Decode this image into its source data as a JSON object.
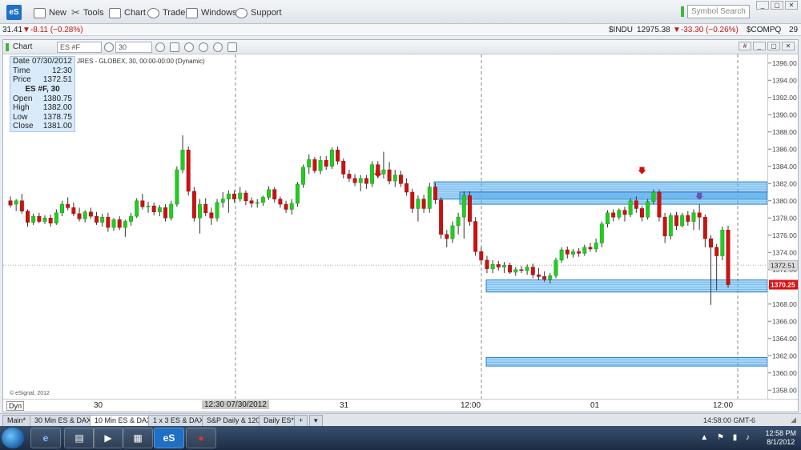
{
  "menubar": {
    "app_logo": "eS",
    "items": [
      "New",
      "Tools",
      "Chart",
      "Trade",
      "Windows",
      "Support"
    ],
    "symbol_search_placeholder": "Symbol Search"
  },
  "ticker": {
    "left_price": "31.41",
    "left_change": "▼-8.11 (−0.28%)",
    "indu_symbol": "$INDU",
    "indu_price": "12975.38",
    "indu_change": "▼-33.30 (−0.26%)",
    "compq_symbol": "$COMPQ",
    "compq_price": "29"
  },
  "chart_window": {
    "title": "Chart",
    "symbol": "ES #F",
    "interval": "30",
    "description": "JRES - GLOBEX, 30, 00:00-00:00 (Dynamic)",
    "copyright": "© eSignal, 2012",
    "dyn_label": "Dyn",
    "current_price_label": "1370.25",
    "crosshair_price_label": "1372.51",
    "crosshair_time_label": "12:30 07/30/2012"
  },
  "info_panel": {
    "rows": [
      {
        "label": "Date",
        "value": "07/30/2012"
      },
      {
        "label": "Time",
        "value": "12:30"
      },
      {
        "label": "Price",
        "value": "1372.51"
      }
    ],
    "header": "ES #F, 30",
    "ohlc": [
      {
        "label": "Open",
        "value": "1380.75"
      },
      {
        "label": "High",
        "value": "1382.00"
      },
      {
        "label": "Low",
        "value": "1378.75"
      },
      {
        "label": "Close",
        "value": "1381.00"
      }
    ]
  },
  "tabs": [
    {
      "label": "Main*",
      "active": false
    },
    {
      "label": "30 Min ES & DAX*",
      "active": false
    },
    {
      "label": "10 Min ES & DAX*",
      "active": true
    },
    {
      "label": "1 x 3 ES & DAX*",
      "active": false
    },
    {
      "label": "S&P Daily & 120*",
      "active": false
    },
    {
      "label": "Daily ES*",
      "active": false
    }
  ],
  "status_clock": "14:58:00 GMT-6",
  "taskbar": {
    "time": "12:58 PM",
    "date": "8/1/2012"
  },
  "colors": {
    "up_candle": "#22cc22",
    "down_candle": "#cc1111",
    "zone_fill": "#5fb4f0",
    "zone_stroke": "#1f7fd0",
    "price_flag": "#dd1111"
  },
  "chart_data": {
    "type": "candlestick",
    "ylim": [
      1357,
      1397
    ],
    "yticks": [
      1358,
      1360,
      1362,
      1364,
      1366,
      1368,
      1370,
      1372,
      1374,
      1376,
      1378,
      1380,
      1382,
      1384,
      1386,
      1388,
      1390,
      1392,
      1394,
      1396
    ],
    "xtick_labels": [
      "30",
      "31",
      "12:00",
      "01",
      "12:00"
    ],
    "zones": [
      {
        "from": 1380.2,
        "to": 1382.2
      },
      {
        "from": 1379.6,
        "to": 1381.0
      },
      {
        "from": 1369.4,
        "to": 1370.8
      },
      {
        "from": 1360.8,
        "to": 1361.8
      }
    ],
    "arrows": [
      {
        "price": 1382.6,
        "color": "#cc1111"
      },
      {
        "price": 1383.0,
        "color": "#cc1111"
      },
      {
        "price": 1380.0,
        "color": "#6a55b5"
      }
    ],
    "candles": [
      {
        "o": 1380.0,
        "h": 1380.5,
        "l": 1379.2,
        "c": 1379.5
      },
      {
        "o": 1379.6,
        "h": 1380.2,
        "l": 1378.8,
        "c": 1380.0
      },
      {
        "o": 1380.0,
        "h": 1380.8,
        "l": 1378.5,
        "c": 1378.8
      },
      {
        "o": 1378.8,
        "h": 1379.0,
        "l": 1377.0,
        "c": 1377.5
      },
      {
        "o": 1377.5,
        "h": 1378.5,
        "l": 1377.2,
        "c": 1378.2
      },
      {
        "o": 1378.2,
        "h": 1378.6,
        "l": 1377.4,
        "c": 1377.6
      },
      {
        "o": 1377.6,
        "h": 1378.3,
        "l": 1377.3,
        "c": 1378.0
      },
      {
        "o": 1378.0,
        "h": 1378.4,
        "l": 1377.0,
        "c": 1377.4
      },
      {
        "o": 1377.4,
        "h": 1379.0,
        "l": 1377.2,
        "c": 1378.6
      },
      {
        "o": 1378.6,
        "h": 1380.0,
        "l": 1378.2,
        "c": 1379.6
      },
      {
        "o": 1379.6,
        "h": 1380.4,
        "l": 1378.9,
        "c": 1379.2
      },
      {
        "o": 1379.2,
        "h": 1379.8,
        "l": 1378.2,
        "c": 1378.5
      },
      {
        "o": 1378.5,
        "h": 1379.2,
        "l": 1377.6,
        "c": 1377.9
      },
      {
        "o": 1377.9,
        "h": 1378.9,
        "l": 1377.5,
        "c": 1378.7
      },
      {
        "o": 1378.7,
        "h": 1379.2,
        "l": 1377.9,
        "c": 1378.2
      },
      {
        "o": 1378.2,
        "h": 1378.7,
        "l": 1377.2,
        "c": 1377.5
      },
      {
        "o": 1377.5,
        "h": 1378.5,
        "l": 1377.0,
        "c": 1378.1
      },
      {
        "o": 1378.1,
        "h": 1378.6,
        "l": 1376.4,
        "c": 1376.9
      },
      {
        "o": 1376.9,
        "h": 1378.0,
        "l": 1376.5,
        "c": 1377.8
      },
      {
        "o": 1377.8,
        "h": 1378.2,
        "l": 1376.6,
        "c": 1376.9
      },
      {
        "o": 1376.9,
        "h": 1377.8,
        "l": 1375.8,
        "c": 1377.6
      },
      {
        "o": 1377.6,
        "h": 1378.6,
        "l": 1377.1,
        "c": 1378.2
      },
      {
        "o": 1378.2,
        "h": 1380.3,
        "l": 1378.0,
        "c": 1380.0
      },
      {
        "o": 1380.0,
        "h": 1380.8,
        "l": 1379.0,
        "c": 1379.3
      },
      {
        "o": 1379.3,
        "h": 1379.9,
        "l": 1378.6,
        "c": 1379.4
      },
      {
        "o": 1379.4,
        "h": 1379.8,
        "l": 1378.3,
        "c": 1378.7
      },
      {
        "o": 1378.7,
        "h": 1379.5,
        "l": 1378.2,
        "c": 1379.2
      },
      {
        "o": 1379.2,
        "h": 1379.6,
        "l": 1377.6,
        "c": 1378.0
      },
      {
        "o": 1378.0,
        "h": 1380.0,
        "l": 1377.7,
        "c": 1379.6
      },
      {
        "o": 1379.6,
        "h": 1384.0,
        "l": 1379.3,
        "c": 1383.6
      },
      {
        "o": 1383.6,
        "h": 1387.6,
        "l": 1383.2,
        "c": 1385.9
      },
      {
        "o": 1385.9,
        "h": 1386.3,
        "l": 1380.6,
        "c": 1381.1
      },
      {
        "o": 1381.1,
        "h": 1381.6,
        "l": 1377.6,
        "c": 1378.0
      },
      {
        "o": 1378.0,
        "h": 1380.2,
        "l": 1376.2,
        "c": 1379.6
      },
      {
        "o": 1379.6,
        "h": 1380.3,
        "l": 1378.2,
        "c": 1378.6
      },
      {
        "o": 1378.6,
        "h": 1379.2,
        "l": 1377.2,
        "c": 1378.0
      },
      {
        "o": 1378.0,
        "h": 1380.2,
        "l": 1377.6,
        "c": 1379.8
      },
      {
        "o": 1379.8,
        "h": 1381.0,
        "l": 1379.2,
        "c": 1380.2
      },
      {
        "o": 1380.2,
        "h": 1381.2,
        "l": 1378.6,
        "c": 1380.8
      },
      {
        "o": 1380.8,
        "h": 1381.2,
        "l": 1379.8,
        "c": 1380.2
      },
      {
        "o": 1380.2,
        "h": 1381.6,
        "l": 1379.9,
        "c": 1380.9
      },
      {
        "o": 1380.9,
        "h": 1381.2,
        "l": 1379.5,
        "c": 1380.0
      },
      {
        "o": 1380.0,
        "h": 1380.4,
        "l": 1379.2,
        "c": 1379.7
      },
      {
        "o": 1379.7,
        "h": 1380.2,
        "l": 1379.2,
        "c": 1379.8
      },
      {
        "o": 1379.8,
        "h": 1380.6,
        "l": 1379.4,
        "c": 1380.4
      },
      {
        "o": 1380.4,
        "h": 1381.7,
        "l": 1380.1,
        "c": 1381.3
      },
      {
        "o": 1381.3,
        "h": 1381.6,
        "l": 1379.8,
        "c": 1380.2
      },
      {
        "o": 1380.2,
        "h": 1380.5,
        "l": 1379.2,
        "c": 1379.6
      },
      {
        "o": 1379.6,
        "h": 1380.0,
        "l": 1378.6,
        "c": 1379.0
      },
      {
        "o": 1379.0,
        "h": 1380.2,
        "l": 1378.4,
        "c": 1379.7
      },
      {
        "o": 1379.7,
        "h": 1382.2,
        "l": 1379.3,
        "c": 1381.9
      },
      {
        "o": 1381.9,
        "h": 1384.2,
        "l": 1381.5,
        "c": 1383.9
      },
      {
        "o": 1383.9,
        "h": 1385.4,
        "l": 1383.1,
        "c": 1384.8
      },
      {
        "o": 1384.8,
        "h": 1385.1,
        "l": 1383.2,
        "c": 1383.5
      },
      {
        "o": 1383.5,
        "h": 1385.2,
        "l": 1383.1,
        "c": 1384.7
      },
      {
        "o": 1384.7,
        "h": 1385.2,
        "l": 1383.6,
        "c": 1384.0
      },
      {
        "o": 1384.0,
        "h": 1386.2,
        "l": 1383.7,
        "c": 1385.9
      },
      {
        "o": 1385.9,
        "h": 1386.3,
        "l": 1384.2,
        "c": 1384.6
      },
      {
        "o": 1384.6,
        "h": 1384.9,
        "l": 1382.6,
        "c": 1383.1
      },
      {
        "o": 1383.1,
        "h": 1383.6,
        "l": 1382.2,
        "c": 1382.6
      },
      {
        "o": 1382.6,
        "h": 1383.1,
        "l": 1381.7,
        "c": 1382.1
      },
      {
        "o": 1382.1,
        "h": 1383.0,
        "l": 1381.1,
        "c": 1382.6
      },
      {
        "o": 1382.6,
        "h": 1383.0,
        "l": 1381.4,
        "c": 1382.0
      },
      {
        "o": 1382.0,
        "h": 1384.6,
        "l": 1381.6,
        "c": 1384.2
      },
      {
        "o": 1384.2,
        "h": 1384.6,
        "l": 1382.6,
        "c": 1383.1
      },
      {
        "o": 1383.1,
        "h": 1385.7,
        "l": 1382.6,
        "c": 1383.6
      },
      {
        "o": 1383.6,
        "h": 1384.5,
        "l": 1381.9,
        "c": 1382.3
      },
      {
        "o": 1382.3,
        "h": 1383.6,
        "l": 1381.6,
        "c": 1383.0
      },
      {
        "o": 1383.0,
        "h": 1383.5,
        "l": 1381.6,
        "c": 1382.0
      },
      {
        "o": 1382.0,
        "h": 1382.6,
        "l": 1380.6,
        "c": 1381.0
      },
      {
        "o": 1381.0,
        "h": 1381.4,
        "l": 1378.6,
        "c": 1379.1
      },
      {
        "o": 1379.1,
        "h": 1380.6,
        "l": 1377.6,
        "c": 1380.2
      },
      {
        "o": 1380.2,
        "h": 1380.7,
        "l": 1378.6,
        "c": 1379.1
      },
      {
        "o": 1379.1,
        "h": 1382.1,
        "l": 1378.6,
        "c": 1381.6
      },
      {
        "o": 1381.6,
        "h": 1382.1,
        "l": 1379.6,
        "c": 1380.1
      },
      {
        "o": 1380.1,
        "h": 1380.4,
        "l": 1375.6,
        "c": 1376.1
      },
      {
        "o": 1376.1,
        "h": 1376.6,
        "l": 1374.6,
        "c": 1375.6
      },
      {
        "o": 1375.6,
        "h": 1377.6,
        "l": 1375.1,
        "c": 1377.1
      },
      {
        "o": 1377.1,
        "h": 1378.6,
        "l": 1376.1,
        "c": 1378.1
      },
      {
        "o": 1378.1,
        "h": 1381.1,
        "l": 1375.6,
        "c": 1380.6
      },
      {
        "o": 1380.6,
        "h": 1381.1,
        "l": 1377.1,
        "c": 1377.6
      },
      {
        "o": 1377.6,
        "h": 1378.1,
        "l": 1373.6,
        "c": 1374.1
      },
      {
        "o": 1374.1,
        "h": 1374.6,
        "l": 1372.6,
        "c": 1373.1
      },
      {
        "o": 1373.1,
        "h": 1373.6,
        "l": 1371.6,
        "c": 1372.1
      },
      {
        "o": 1372.1,
        "h": 1373.1,
        "l": 1371.6,
        "c": 1372.6
      },
      {
        "o": 1372.6,
        "h": 1373.0,
        "l": 1371.9,
        "c": 1372.3
      },
      {
        "o": 1372.3,
        "h": 1372.9,
        "l": 1371.6,
        "c": 1372.5
      },
      {
        "o": 1372.5,
        "h": 1372.8,
        "l": 1371.5,
        "c": 1371.7
      },
      {
        "o": 1371.7,
        "h": 1372.3,
        "l": 1371.3,
        "c": 1372.0
      },
      {
        "o": 1372.0,
        "h": 1372.4,
        "l": 1371.6,
        "c": 1371.9
      },
      {
        "o": 1371.9,
        "h": 1372.6,
        "l": 1371.4,
        "c": 1372.3
      },
      {
        "o": 1372.3,
        "h": 1372.7,
        "l": 1371.0,
        "c": 1371.4
      },
      {
        "o": 1371.4,
        "h": 1372.2,
        "l": 1370.8,
        "c": 1371.2
      },
      {
        "o": 1371.2,
        "h": 1371.8,
        "l": 1370.6,
        "c": 1370.9
      },
      {
        "o": 1370.9,
        "h": 1371.6,
        "l": 1370.4,
        "c": 1371.3
      },
      {
        "o": 1371.3,
        "h": 1373.4,
        "l": 1371.0,
        "c": 1373.1
      },
      {
        "o": 1373.1,
        "h": 1374.6,
        "l": 1372.8,
        "c": 1374.3
      },
      {
        "o": 1374.3,
        "h": 1374.7,
        "l": 1373.3,
        "c": 1373.8
      },
      {
        "o": 1373.8,
        "h": 1374.4,
        "l": 1373.4,
        "c": 1374.1
      },
      {
        "o": 1374.1,
        "h": 1374.5,
        "l": 1373.5,
        "c": 1373.9
      },
      {
        "o": 1373.9,
        "h": 1374.9,
        "l": 1373.6,
        "c": 1374.6
      },
      {
        "o": 1374.6,
        "h": 1375.1,
        "l": 1374.1,
        "c": 1374.4
      },
      {
        "o": 1374.4,
        "h": 1375.6,
        "l": 1374.0,
        "c": 1375.1
      },
      {
        "o": 1375.1,
        "h": 1377.6,
        "l": 1374.6,
        "c": 1377.3
      },
      {
        "o": 1377.3,
        "h": 1378.9,
        "l": 1376.9,
        "c": 1378.6
      },
      {
        "o": 1378.6,
        "h": 1379.0,
        "l": 1377.6,
        "c": 1378.1
      },
      {
        "o": 1378.1,
        "h": 1379.1,
        "l": 1377.8,
        "c": 1378.9
      },
      {
        "o": 1378.9,
        "h": 1379.3,
        "l": 1377.6,
        "c": 1378.4
      },
      {
        "o": 1378.4,
        "h": 1380.3,
        "l": 1378.1,
        "c": 1380.0
      },
      {
        "o": 1380.0,
        "h": 1380.5,
        "l": 1378.6,
        "c": 1379.1
      },
      {
        "o": 1379.1,
        "h": 1379.4,
        "l": 1377.6,
        "c": 1378.1
      },
      {
        "o": 1378.1,
        "h": 1380.2,
        "l": 1377.8,
        "c": 1379.9
      },
      {
        "o": 1379.9,
        "h": 1381.3,
        "l": 1379.6,
        "c": 1381.0
      },
      {
        "o": 1381.0,
        "h": 1381.3,
        "l": 1377.6,
        "c": 1378.1
      },
      {
        "o": 1378.1,
        "h": 1378.6,
        "l": 1375.1,
        "c": 1375.9
      },
      {
        "o": 1375.9,
        "h": 1378.6,
        "l": 1375.5,
        "c": 1378.3
      },
      {
        "o": 1378.3,
        "h": 1378.7,
        "l": 1376.6,
        "c": 1377.1
      },
      {
        "o": 1377.1,
        "h": 1378.6,
        "l": 1376.9,
        "c": 1378.3
      },
      {
        "o": 1378.3,
        "h": 1378.8,
        "l": 1377.1,
        "c": 1377.6
      },
      {
        "o": 1377.6,
        "h": 1379.0,
        "l": 1376.6,
        "c": 1378.6
      },
      {
        "o": 1378.6,
        "h": 1379.6,
        "l": 1376.6,
        "c": 1378.1
      },
      {
        "o": 1378.1,
        "h": 1378.4,
        "l": 1374.6,
        "c": 1375.6
      },
      {
        "o": 1375.6,
        "h": 1376.0,
        "l": 1367.9,
        "c": 1374.6
      },
      {
        "o": 1374.6,
        "h": 1375.0,
        "l": 1369.6,
        "c": 1373.6
      },
      {
        "o": 1373.6,
        "h": 1377.0,
        "l": 1373.1,
        "c": 1376.6
      },
      {
        "o": 1376.6,
        "h": 1377.1,
        "l": 1369.9,
        "c": 1370.25
      }
    ]
  }
}
